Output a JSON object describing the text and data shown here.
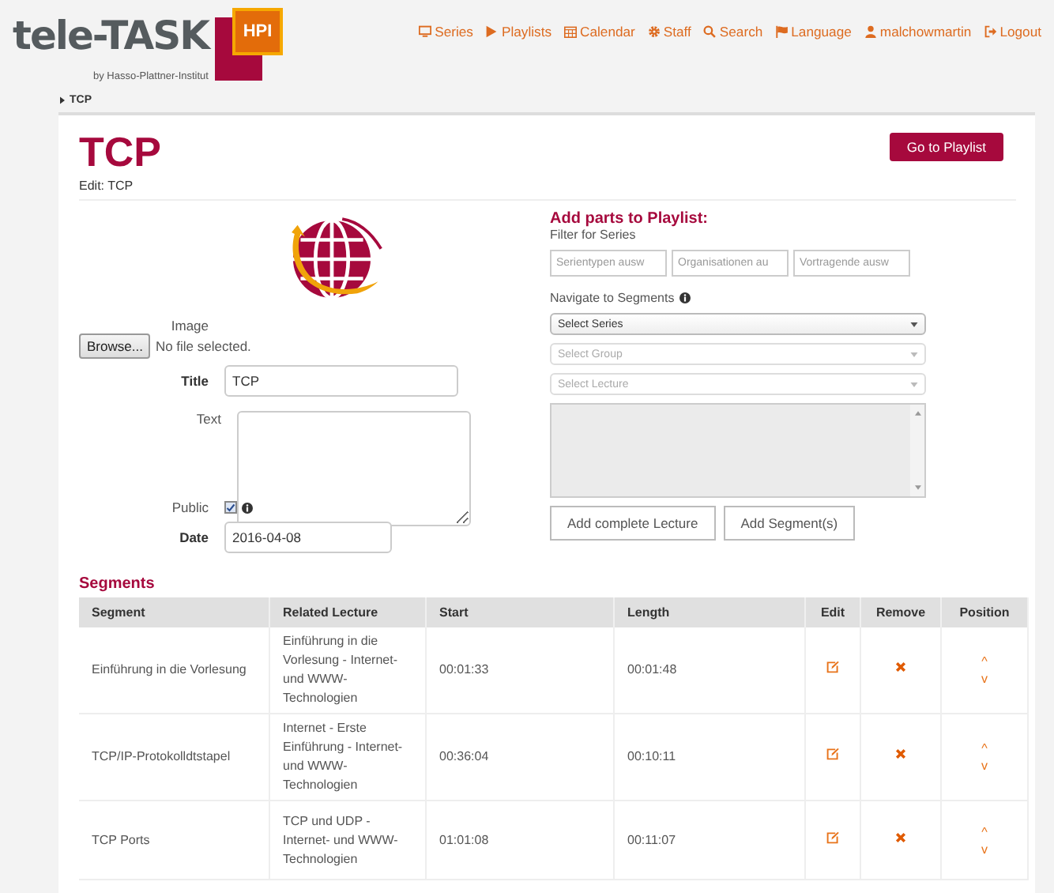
{
  "brand": {
    "name": "tele-TASK",
    "badge": "HPI",
    "byline": "by Hasso-Plattner-Institut"
  },
  "nav": [
    "Series",
    "Playlists",
    "Calendar",
    "Staff",
    "Search",
    "Language",
    "malchowmartin",
    "Logout"
  ],
  "breadcrumb": "TCP",
  "page": {
    "title": "TCP",
    "subtitle": "Edit: TCP",
    "action": "Go to Playlist"
  },
  "form": {
    "image_label": "Image",
    "browse": "Browse...",
    "no_file": "No file selected.",
    "title_label": "Title",
    "title_value": "TCP",
    "text_label": "Text",
    "public_label": "Public",
    "public_checked": true,
    "date_label": "Date",
    "date_value": "2016-04-08"
  },
  "playlist": {
    "heading": "Add parts to Playlist:",
    "filter_label": "Filter for Series",
    "filters": [
      {
        "placeholder": "Serientypen ausw"
      },
      {
        "placeholder": "Organisationen au"
      },
      {
        "placeholder": "Vortragende ausw"
      }
    ],
    "navigate_label": "Navigate to Segments",
    "selects": [
      {
        "label": "Select Series",
        "disabled": false
      },
      {
        "label": "Select Group",
        "disabled": true
      },
      {
        "label": "Select Lecture",
        "disabled": true
      }
    ],
    "buttons": [
      "Add complete Lecture",
      "Add Segment(s)"
    ]
  },
  "segments": {
    "heading": "Segments",
    "columns": [
      "Segment",
      "Related Lecture",
      "Start",
      "Length",
      "Edit",
      "Remove",
      "Position"
    ],
    "rows": [
      {
        "segment": "Einführung in die Vorlesung",
        "lecture": "Einführung in die Vorlesung - Internet- und WWW-Technologien",
        "start": "00:01:33",
        "length": "00:01:48",
        "up": "^",
        "down": "v"
      },
      {
        "segment": "TCP/IP-Protokolldtstapel",
        "lecture": "Internet - Erste Einführung - Internet- und WWW-Technologien",
        "start": "00:36:04",
        "length": "00:10:11",
        "up": "^",
        "down": "v"
      },
      {
        "segment": "TCP Ports",
        "lecture": "TCP und UDP - Internet- und WWW-Technologien",
        "start": "01:01:08",
        "length": "00:11:07",
        "up": "^",
        "down": "v"
      }
    ]
  }
}
